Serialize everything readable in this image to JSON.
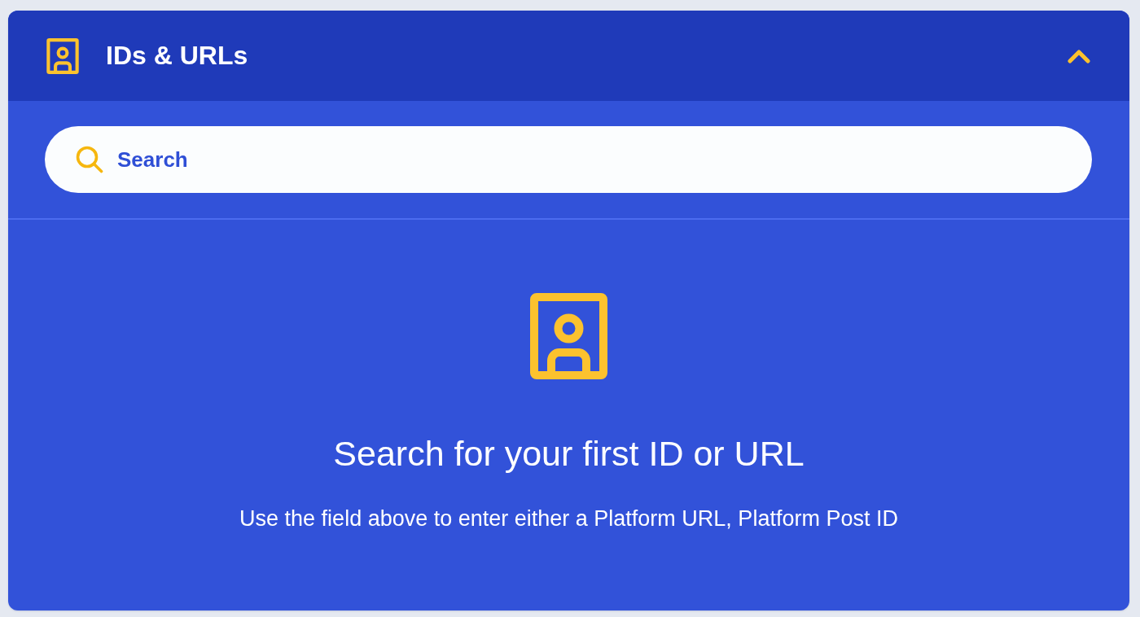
{
  "panel": {
    "title": "IDs & URLs",
    "expanded": true
  },
  "search": {
    "placeholder": "Search"
  },
  "empty_state": {
    "heading": "Search for your first ID or URL",
    "description": "Use the field above to enter either a Platform URL, Platform Post ID"
  }
}
